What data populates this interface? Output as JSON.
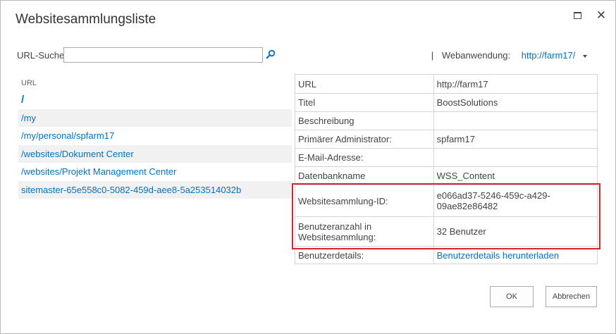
{
  "dialog": {
    "title": "Websitesammlungsliste"
  },
  "search": {
    "label": "URL-Suche",
    "value": "",
    "placeholder": ""
  },
  "webapp": {
    "separator": "|",
    "label": "Webanwendung:",
    "value": "http://farm17/"
  },
  "url_list": {
    "header": "URL",
    "items": [
      "/",
      "/my",
      "/my/personal/spfarm17",
      "/websites/Dokument Center",
      "/websites/Projekt Management Center",
      "sitemaster-65e558c0-5082-459d-aee8-5a253514032b"
    ]
  },
  "details": {
    "rows": [
      {
        "key": "URL",
        "value": "http://farm17"
      },
      {
        "key": "Titel",
        "value": "BoostSolutions"
      },
      {
        "key": "Beschreibung",
        "value": ""
      },
      {
        "key": "Primärer Administrator:",
        "value": "spfarm17"
      },
      {
        "key": "E-Mail-Adresse:",
        "value": ""
      },
      {
        "key": "Datenbankname",
        "value": "WSS_Content"
      },
      {
        "key": "Websitesammlung-ID:",
        "value": "e066ad37-5246-459c-a429-09ae82e86482"
      },
      {
        "key": "Benutzeranzahl in Websitesammlung:",
        "value": "32 Benutzer"
      },
      {
        "key": "Benutzerdetails:",
        "value": "Benutzerdetails herunterladen"
      }
    ]
  },
  "buttons": {
    "ok": "OK",
    "cancel": "Abbrechen"
  },
  "colors": {
    "link": "#0072c6",
    "highlight": "#d9222a"
  }
}
